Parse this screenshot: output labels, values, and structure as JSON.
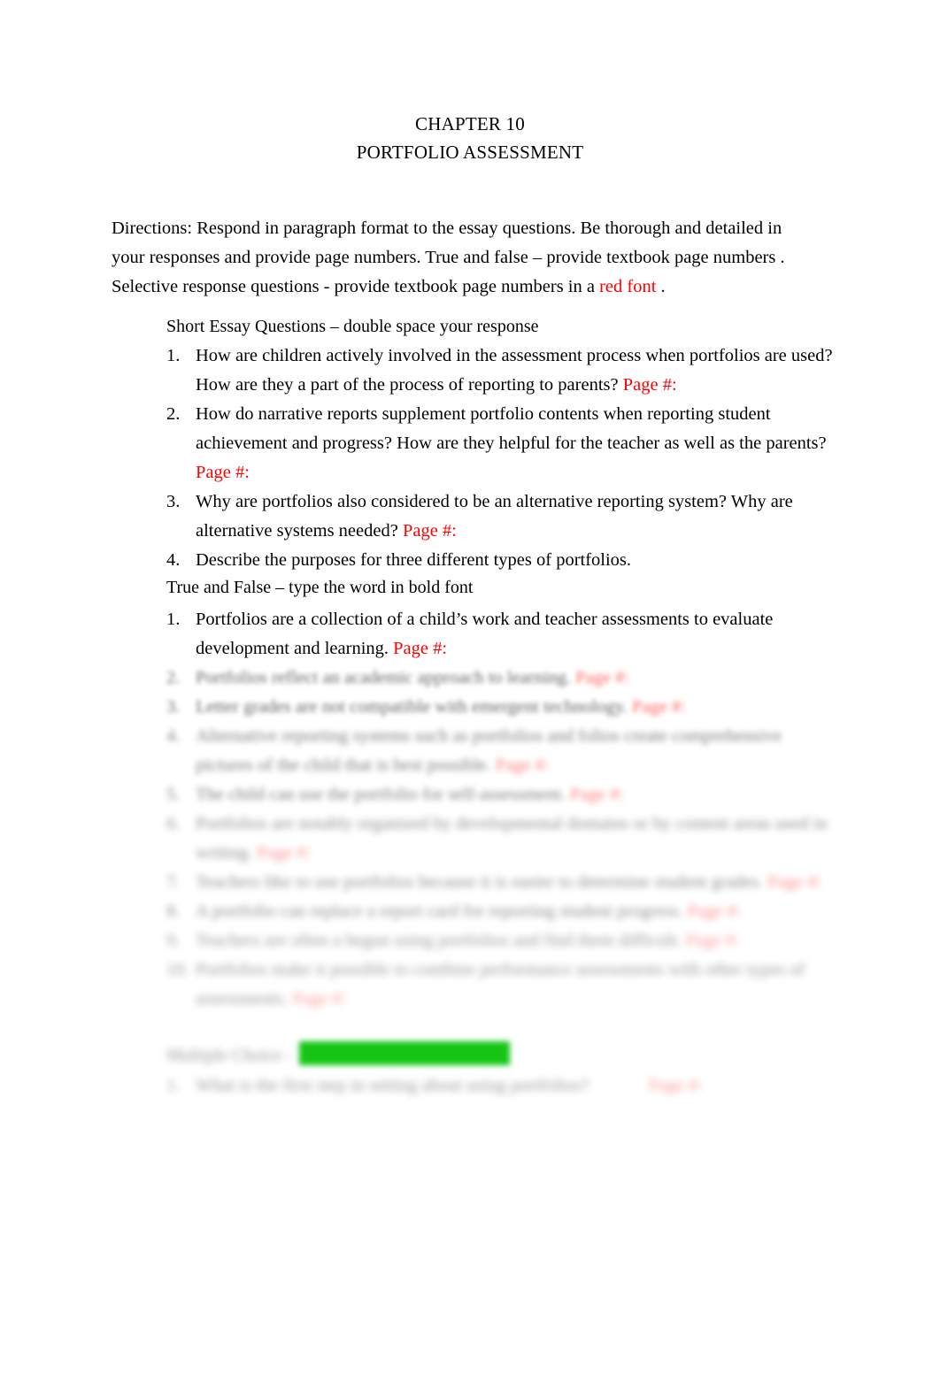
{
  "document": {
    "title_line_1": "CHAPTER 10",
    "title_line_2": "PORTFOLIO ASSESSMENT",
    "red_accent_color": "#ff0000",
    "highlight_color": "#14c514",
    "page_background": "#ffffff"
  },
  "directions": {
    "text_before_red": "Directions: Respond in paragraph format to the essay questions.  Be thorough and detailed in your responses and provide page numbers.  True and false –  provide textbook page numbers .  Selective response questions - provide textbook page numbers in a  ",
    "red_text": "red font",
    "text_after_red": " ."
  },
  "essay_section": {
    "heading": "Short Essay Questions – double space your response",
    "items": [
      {
        "number": "1.",
        "text": "How are children actively involved in the assessment process when portfolios are used?  How are they a part of the process of reporting to parents? ",
        "page_marker": "Page #:"
      },
      {
        "number": "2.",
        "text": "How do narrative reports supplement portfolio contents when reporting student achievement and progress?  How are they helpful for the teacher as well as the parents? ",
        "page_marker": "Page #:"
      },
      {
        "number": "3.",
        "text": "Why are portfolios also considered to be an alternative reporting system?  Why are alternative systems needed? ",
        "page_marker": "Page #:"
      },
      {
        "number": "4.",
        "text": "Describe the purposes for three different types of portfolios.",
        "page_marker": ""
      }
    ]
  },
  "true_false_section": {
    "heading": "True and False – type the word in bold font",
    "items": [
      {
        "number": "1.",
        "text": "Portfolios are a collection of a child’s work and teacher assessments to evaluate development and learning. ",
        "page_marker": "Page #:",
        "blur_level": 0
      },
      {
        "number": "2.",
        "text": "Portfolios reflect an academic approach to learning. ",
        "page_marker": "Page #:",
        "blur_level": 1
      },
      {
        "number": "3.",
        "text": "Letter grades are not compatible with emergent technology. ",
        "page_marker": "Page #:",
        "blur_level": 1
      },
      {
        "number": "4.",
        "text": "Alternative reporting systems such as portfolios and folios create comprehensive pictures of the child that is best possible. ",
        "page_marker": "Page #:",
        "blur_level": 2
      },
      {
        "number": "5.",
        "text": "The child can use the portfolio for self-assessment. ",
        "page_marker": "Page #:",
        "blur_level": 2
      },
      {
        "number": "6.",
        "text": "Portfolios are notably organized by developmental domains or by content areas used in writing. ",
        "page_marker": "Page #:",
        "blur_level": 3
      },
      {
        "number": "7.",
        "text": "Teachers like to use portfolios because it is easier to determine student grades. ",
        "page_marker": "Page #:",
        "blur_level": 3
      },
      {
        "number": "8.",
        "text": "A portfolio can replace a report card for reporting student progress. ",
        "page_marker": "Page #:",
        "blur_level": 3
      },
      {
        "number": "9.",
        "text": "Teachers are often a begun using portfolios and find them difficult. ",
        "page_marker": "Page #:",
        "blur_level": 4
      },
      {
        "number": "10.",
        "text": "Portfolios make it possible to combine performance assessments with other types of assessments. ",
        "page_marker": "Page #:",
        "blur_level": 4
      }
    ]
  },
  "multiple_choice_section": {
    "heading": "Multiple Choice  -",
    "highlight_bar_label": "",
    "items": [
      {
        "number": "1.",
        "text": "What is the first step in setting about using portfolios?",
        "page_marker": "Page #:",
        "blur_level": 4
      }
    ]
  }
}
